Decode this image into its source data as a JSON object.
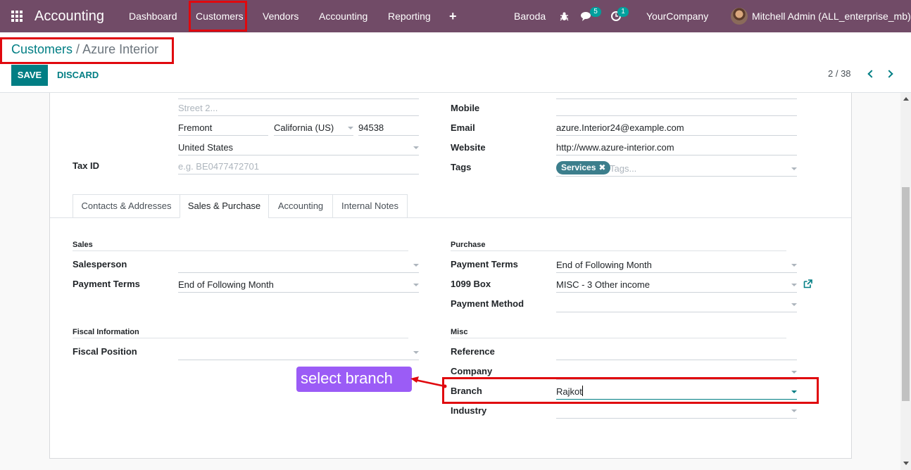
{
  "navbar": {
    "brand": "Accounting",
    "menu": [
      "Dashboard",
      "Customers",
      "Vendors",
      "Accounting",
      "Reporting"
    ],
    "plus_label": "+",
    "branch": "Baroda",
    "messages_count": "5",
    "activities_count": "1",
    "company": "YourCompany",
    "user": "Mitchell Admin (ALL_enterprise_mb)"
  },
  "breadcrumb": {
    "parent": "Customers",
    "separator": "/",
    "current": "Azure Interior"
  },
  "control": {
    "save_label": "SAVE",
    "discard_label": "DISCARD",
    "pager": "2 / 38"
  },
  "address": {
    "street2_placeholder": "Street 2...",
    "city": "Fremont",
    "state": "California (US)",
    "zip": "94538",
    "country": "United States",
    "tax_id_label": "Tax ID",
    "tax_id_placeholder": "e.g. BE0477472701"
  },
  "contact": {
    "mobile_label": "Mobile",
    "email_label": "Email",
    "email": "azure.Interior24@example.com",
    "website_label": "Website",
    "website": "http://www.azure-interior.com",
    "tags_label": "Tags",
    "tag": "Services",
    "tag_remove": "✖",
    "tags_placeholder": "Tags..."
  },
  "tabs": [
    "Contacts & Addresses",
    "Sales & Purchase",
    "Accounting",
    "Internal Notes"
  ],
  "sales": {
    "section": "Sales",
    "salesperson_label": "Salesperson",
    "payment_terms_label": "Payment Terms",
    "payment_terms": "End of Following Month"
  },
  "fiscal": {
    "section": "Fiscal Information",
    "position_label": "Fiscal Position"
  },
  "purchase": {
    "section": "Purchase",
    "payment_terms_label": "Payment Terms",
    "payment_terms": "End of Following Month",
    "box_1099_label": "1099 Box",
    "box_1099": "MISC - 3 Other income",
    "payment_method_label": "Payment Method"
  },
  "misc": {
    "section": "Misc",
    "reference_label": "Reference",
    "company_label": "Company",
    "branch_label": "Branch",
    "branch": "Rajkot",
    "industry_label": "Industry"
  },
  "annotation": {
    "callout": "select branch"
  },
  "colors": {
    "navbar": "#714b67",
    "primary": "#017e84",
    "annotation_red": "#e0080e",
    "callout_purple": "#9b5cf6"
  }
}
